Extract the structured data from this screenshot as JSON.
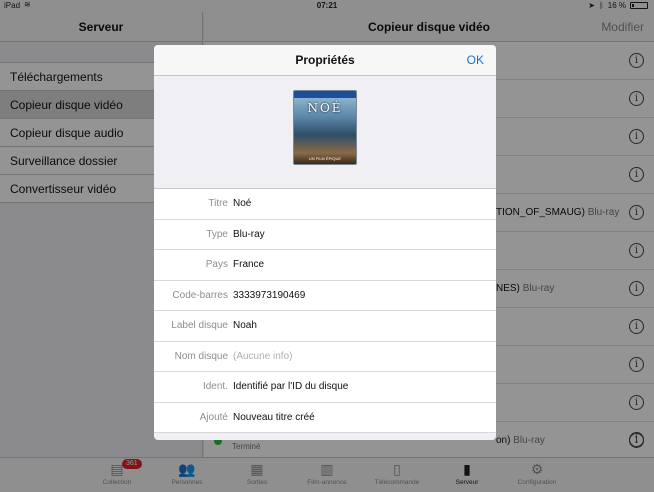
{
  "status_bar": {
    "carrier": "iPad",
    "time": "07:21",
    "battery": "16 %",
    "battery_level": 0.16
  },
  "left_pane": {
    "title": "Serveur",
    "items": [
      {
        "label": "Téléchargements"
      },
      {
        "label": "Copieur disque vidéo"
      },
      {
        "label": "Copieur disque audio"
      },
      {
        "label": "Surveillance dossier"
      },
      {
        "label": "Convertisseur vidéo"
      }
    ]
  },
  "right_pane": {
    "title": "Copieur disque vidéo",
    "modify_label": "Modifier",
    "rows": [
      {
        "text": "",
        "kind": ""
      },
      {
        "text": "",
        "kind": ""
      },
      {
        "text": "",
        "kind": ""
      },
      {
        "text": "",
        "kind": ""
      },
      {
        "text": "TION_OF_SMAUG)",
        "kind": "Blu-ray"
      },
      {
        "text": "",
        "kind": ""
      },
      {
        "text": "NES)",
        "kind": "Blu-ray"
      },
      {
        "text": "",
        "kind": ""
      },
      {
        "text": "",
        "kind": ""
      },
      {
        "text": "",
        "kind": ""
      },
      {
        "text": "on)",
        "kind": "Blu-ray"
      }
    ],
    "last_status": "Terminé",
    "info_glyph": "i"
  },
  "tab_bar": {
    "tabs": [
      {
        "label": "Collection",
        "badge": "361",
        "icon": "film-strip-icon"
      },
      {
        "label": "Personnes",
        "icon": "people-icon"
      },
      {
        "label": "Sorties",
        "icon": "calendar-icon"
      },
      {
        "label": "Film-annonce",
        "icon": "trailer-icon"
      },
      {
        "label": "Télécommande",
        "icon": "remote-icon"
      },
      {
        "label": "Serveur",
        "icon": "server-icon"
      },
      {
        "label": "Configuration",
        "icon": "gear-icon"
      }
    ],
    "active": "Serveur"
  },
  "modal": {
    "title": "Propriétés",
    "ok_label": "OK",
    "cover": {
      "title": "NOÉ",
      "subtitle": "UN FILM ÉPIQUE"
    },
    "properties": [
      {
        "label": "Titre",
        "value": "Noé"
      },
      {
        "label": "Type",
        "value": "Blu-ray"
      },
      {
        "label": "Pays",
        "value": "France"
      },
      {
        "label": "Code-barres",
        "value": "3333973190469"
      },
      {
        "label": "Label disque",
        "value": "Noah"
      },
      {
        "label": "Nom disque",
        "value": "(Aucune info)"
      },
      {
        "label": "Ident.",
        "value": "Identifié par l'ID du disque"
      },
      {
        "label": "Ajouté",
        "value": "Nouveau titre créé"
      }
    ]
  }
}
